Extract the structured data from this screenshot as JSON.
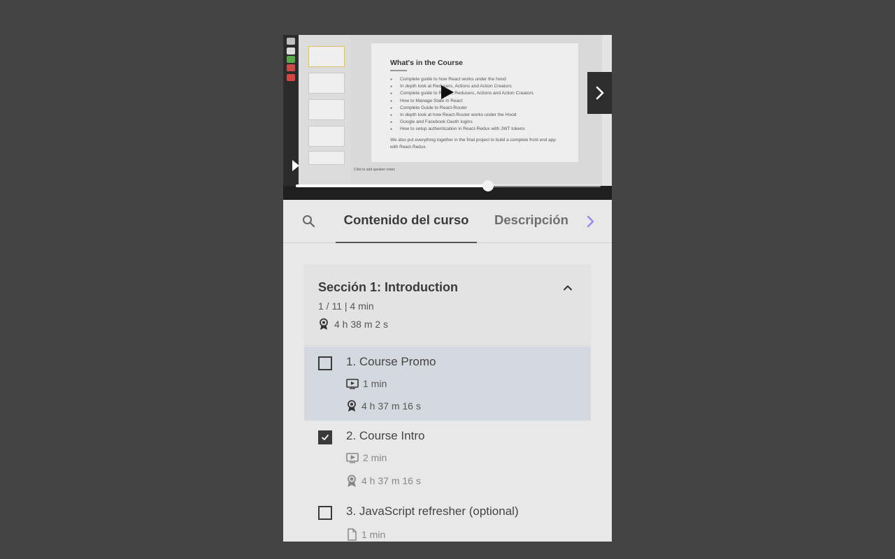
{
  "video": {
    "slide": {
      "title": "What's in the Course",
      "bullets": [
        "Complete guide to how React works under the hood",
        "In depth look at Reducers, Actions and Action Creators",
        "Complete guide to Redux, Reducers, Actions and Action Creators",
        "How to Manage State in React",
        "Complete Guide to React-Router",
        "In depth look at how React-Router works under the Hood",
        "Google and Facebook Oauth logins",
        "How to setup authentication in React-Redux with JWT tokens"
      ],
      "footer": "We also put everything together in the final project to build a complete front end app with React-Redux.",
      "speaker_notes": "Click to add speaker notes"
    },
    "progress": 0.63
  },
  "tabs": {
    "active_label": "Contenido del curso",
    "second_label": "Descripción"
  },
  "section": {
    "title": "Sección 1: Introduction",
    "meta": "1 / 11 | 4 min",
    "total_time": "4 h 38 m 2 s"
  },
  "lessons": [
    {
      "title": "1. Course Promo",
      "duration": "1 min",
      "time": "4 h 37 m 16 s"
    },
    {
      "title": "2. Course Intro",
      "duration": "2 min",
      "time": "4 h 37 m 16 s"
    },
    {
      "title": "3. JavaScript refresher (optional)",
      "duration": "1 min"
    }
  ],
  "colors": {
    "background": "#444444",
    "panel": "#e8e8e8",
    "current_lesson": "#d4d9e0",
    "accent_arrow": "#9b86e8"
  }
}
